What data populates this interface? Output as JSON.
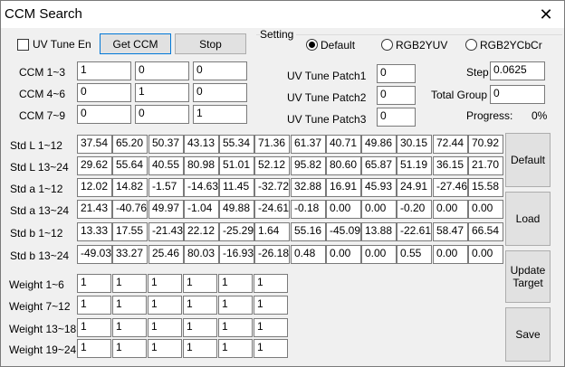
{
  "window": {
    "title": "CCM Search",
    "close_glyph": "✕"
  },
  "top": {
    "uv_tune_en": "UV Tune En",
    "get_ccm": "Get CCM",
    "stop": "Stop",
    "setting": "Setting",
    "radios": [
      {
        "label": "Default",
        "checked": true
      },
      {
        "label": "RGB2YUV",
        "checked": false
      },
      {
        "label": "RGB2YCbCr",
        "checked": false
      }
    ]
  },
  "ccm": {
    "rows": [
      {
        "label": "CCM 1~3",
        "values": [
          "1",
          "0",
          "0"
        ]
      },
      {
        "label": "CCM 4~6",
        "values": [
          "0",
          "1",
          "0"
        ]
      },
      {
        "label": "CCM 7~9",
        "values": [
          "0",
          "0",
          "1"
        ]
      }
    ]
  },
  "uv": {
    "patches": [
      {
        "label": "UV Tune Patch1",
        "value": "0"
      },
      {
        "label": "UV Tune Patch2",
        "value": "0"
      },
      {
        "label": "UV Tune Patch3",
        "value": "0"
      }
    ]
  },
  "right": {
    "step_label": "Step",
    "step_value": "0.0625",
    "total_group_label": "Total Group",
    "total_group_value": "0",
    "progress_label": "Progress:",
    "progress_value": "0%"
  },
  "std": {
    "rows": [
      {
        "label": "Std L 1~12",
        "values": [
          "37.54",
          "65.20",
          "50.37",
          "43.13",
          "55.34",
          "71.36",
          "61.37",
          "40.71",
          "49.86",
          "30.15",
          "72.44",
          "70.92"
        ]
      },
      {
        "label": "Std L 13~24",
        "values": [
          "29.62",
          "55.64",
          "40.55",
          "80.98",
          "51.01",
          "52.12",
          "95.82",
          "80.60",
          "65.87",
          "51.19",
          "36.15",
          "21.70"
        ]
      },
      {
        "label": "Std a 1~12",
        "values": [
          "12.02",
          "14.82",
          "-1.57",
          "-14.63",
          "11.45",
          "-32.72",
          "32.88",
          "16.91",
          "45.93",
          "24.91",
          "-27.46",
          "15.58"
        ]
      },
      {
        "label": "Std a 13~24",
        "values": [
          "21.43",
          "-40.76",
          "49.97",
          "-1.04",
          "49.88",
          "-24.61",
          "-0.18",
          "0.00",
          "0.00",
          "-0.20",
          "0.00",
          "0.00"
        ]
      },
      {
        "label": "Std b 1~12",
        "values": [
          "13.33",
          "17.55",
          "-21.43",
          "22.12",
          "-25.29",
          "1.64",
          "55.16",
          "-45.09",
          "13.88",
          "-22.61",
          "58.47",
          "66.54"
        ]
      },
      {
        "label": "Std b 13~24",
        "values": [
          "-49.03",
          "33.27",
          "25.46",
          "80.03",
          "-16.93",
          "-26.18",
          "0.48",
          "0.00",
          "0.00",
          "0.55",
          "0.00",
          "0.00"
        ]
      }
    ]
  },
  "weights": {
    "rows": [
      {
        "label": "Weight 1~6",
        "values": [
          "1",
          "1",
          "1",
          "1",
          "1",
          "1"
        ]
      },
      {
        "label": "Weight 7~12",
        "values": [
          "1",
          "1",
          "1",
          "1",
          "1",
          "1"
        ]
      },
      {
        "label": "Weight 13~18",
        "values": [
          "1",
          "1",
          "1",
          "1",
          "1",
          "1"
        ]
      },
      {
        "label": "Weight 19~24",
        "values": [
          "1",
          "1",
          "1",
          "1",
          "1",
          "1"
        ]
      }
    ]
  },
  "side_buttons": {
    "default": "Default",
    "load": "Load",
    "update_target_1": "Update",
    "update_target_2": "Target",
    "save": "Save"
  }
}
